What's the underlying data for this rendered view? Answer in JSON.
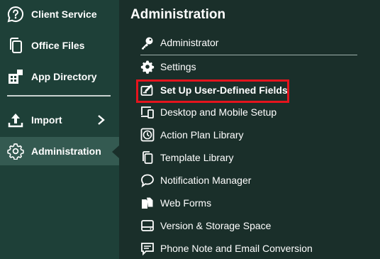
{
  "sidebar": {
    "items": [
      {
        "label": "Client Service",
        "icon": "question-bubble-icon"
      },
      {
        "label": "Office Files",
        "icon": "copy-files-icon"
      },
      {
        "label": "App Directory",
        "icon": "app-directory-icon"
      },
      {
        "label": "Import",
        "icon": "upload-icon"
      },
      {
        "label": "Administration",
        "icon": "gear-icon"
      }
    ],
    "active": "Administration"
  },
  "panel": {
    "title": "Administration",
    "items": [
      {
        "label": "Administrator",
        "icon": "key-icon"
      },
      {
        "label": "Settings",
        "icon": "gear-icon"
      },
      {
        "label": "Set Up User-Defined Fields",
        "icon": "edit-field-icon",
        "highlighted": true
      },
      {
        "label": "Desktop and Mobile Setup",
        "icon": "devices-icon"
      },
      {
        "label": "Action Plan Library",
        "icon": "clock-icon"
      },
      {
        "label": "Template Library",
        "icon": "copy-icon"
      },
      {
        "label": "Notification Manager",
        "icon": "speech-bubble-icon"
      },
      {
        "label": "Web Forms",
        "icon": "files-icon"
      },
      {
        "label": "Version & Storage Space",
        "icon": "storage-icon"
      },
      {
        "label": "Phone Note and Email Conversion",
        "icon": "note-icon"
      }
    ]
  },
  "colors": {
    "sidebar_bg": "#1e4038",
    "panel_bg": "#1a2f2a",
    "active_bg": "#345a51",
    "highlight_border": "#e5141d"
  }
}
